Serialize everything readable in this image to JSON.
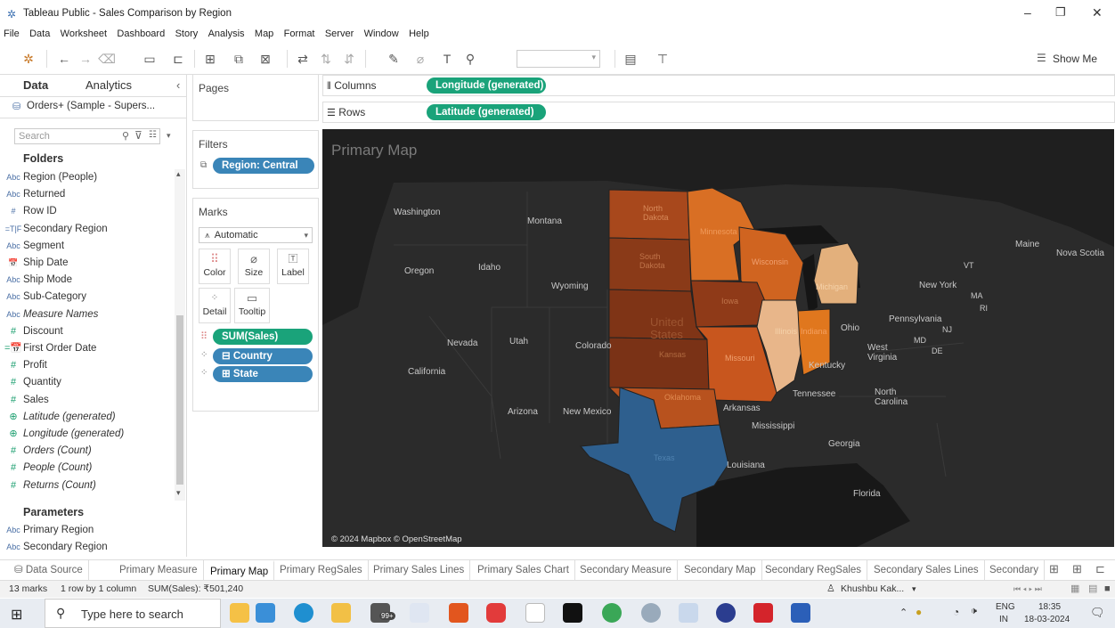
{
  "window": {
    "title": "Tableau Public - Sales Comparison by Region",
    "controls": [
      "–",
      "❐",
      "✕"
    ]
  },
  "menu": [
    "File",
    "Data",
    "Worksheet",
    "Dashboard",
    "Story",
    "Analysis",
    "Map",
    "Format",
    "Server",
    "Window",
    "Help"
  ],
  "toolbar": {
    "show_me": "Show Me"
  },
  "left_pane": {
    "tabs": [
      "Data",
      "Analytics"
    ],
    "datasource": "Orders+ (Sample - Supers...",
    "search_placeholder": "Search",
    "folders_heading": "Folders",
    "fields": [
      {
        "type": "Abc",
        "name": "Region (People)",
        "kind": "dim",
        "italic": false
      },
      {
        "type": "Abc",
        "name": "Returned",
        "kind": "dim",
        "italic": false
      },
      {
        "type": "#",
        "name": "Row ID",
        "kind": "dim",
        "italic": false
      },
      {
        "type": "=T|F",
        "name": "Secondary Region",
        "kind": "dim",
        "italic": false
      },
      {
        "type": "Abc",
        "name": "Segment",
        "kind": "dim",
        "italic": false
      },
      {
        "type": "📅",
        "name": "Ship Date",
        "kind": "dim",
        "italic": false
      },
      {
        "type": "Abc",
        "name": "Ship Mode",
        "kind": "dim",
        "italic": false
      },
      {
        "type": "Abc",
        "name": "Sub-Category",
        "kind": "dim",
        "italic": false
      },
      {
        "type": "Abc",
        "name": "Measure Names",
        "kind": "dim",
        "italic": true
      },
      {
        "type": "#",
        "name": "Discount",
        "kind": "meas",
        "italic": false
      },
      {
        "type": "=📅",
        "name": "First Order Date",
        "kind": "meas",
        "italic": false
      },
      {
        "type": "#",
        "name": "Profit",
        "kind": "meas",
        "italic": false
      },
      {
        "type": "#",
        "name": "Quantity",
        "kind": "meas",
        "italic": false
      },
      {
        "type": "#",
        "name": "Sales",
        "kind": "meas",
        "italic": false
      },
      {
        "type": "⊕",
        "name": "Latitude (generated)",
        "kind": "meas",
        "italic": true
      },
      {
        "type": "⊕",
        "name": "Longitude (generated)",
        "kind": "meas",
        "italic": true
      },
      {
        "type": "#",
        "name": "Orders (Count)",
        "kind": "meas",
        "italic": true
      },
      {
        "type": "#",
        "name": "People (Count)",
        "kind": "meas",
        "italic": true
      },
      {
        "type": "#",
        "name": "Returns (Count)",
        "kind": "meas",
        "italic": true
      }
    ],
    "parameters_heading": "Parameters",
    "parameters": [
      {
        "type": "Abc",
        "name": "Primary Region"
      },
      {
        "type": "Abc",
        "name": "Secondary Region"
      }
    ]
  },
  "cards": {
    "pages": "Pages",
    "filters": "Filters",
    "filter_pill": "Region: Central",
    "marks": "Marks",
    "mark_type": "Automatic",
    "mark_buttons": [
      "Color",
      "Size",
      "Label",
      "Detail",
      "Tooltip"
    ],
    "mark_pills": [
      "SUM(Sales)",
      "⊟ Country",
      "⊞ State"
    ]
  },
  "shelves": {
    "columns_label": "Columns",
    "columns_pill": "Longitude (generated)",
    "rows_label": "Rows",
    "rows_pill": "Latitude (generated)"
  },
  "viz": {
    "title": "Primary Map",
    "attribution": "© 2024 Mapbox © OpenStreetMap",
    "labels": {
      "washington": "Washington",
      "montana": "Montana",
      "oregon": "Oregon",
      "idaho": "Idaho",
      "wyoming": "Wyoming",
      "nevada": "Nevada",
      "utah": "Utah",
      "colorado": "Colorado",
      "california": "California",
      "arizona": "Arizona",
      "new_mexico": "New Mexico",
      "north_dakota": "North Dakota",
      "south_dakota": "South Dakota",
      "minnesota": "Minnesota",
      "wisconsin": "Wisconsin",
      "michigan": "Michigan",
      "iowa": "Iowa",
      "illinois": "Illinois",
      "indiana": "Indiana",
      "missouri": "Missouri",
      "kansas": "Kansas",
      "oklahoma": "Oklahoma",
      "texas": "Texas",
      "united_states": "United States",
      "ohio": "Ohio",
      "kentucky": "Kentucky",
      "tennessee": "Tennessee",
      "arkansas": "Arkansas",
      "mississippi": "Mississippi",
      "louisiana": "Louisiana",
      "georgia": "Georgia",
      "florida": "Florida",
      "north_carolina": "North Carolina",
      "west_virginia": "West Virginia",
      "pennsylvania": "Pennsylvania",
      "new_york": "New York",
      "maine": "Maine",
      "nova_scotia": "Nova Scotia",
      "vt": "VT",
      "ma": "MA",
      "ri": "RI",
      "md": "MD",
      "de": "DE",
      "nj": "NJ"
    }
  },
  "sheet_tabs": {
    "data_source": "Data Source",
    "tabs": [
      "Primary Measure",
      "Primary Map",
      "Primary RegSales",
      "Primary Sales Lines",
      "Primary Sales Chart",
      "Secondary Measure",
      "Secondary Map",
      "Secondary RegSales",
      "Secondary Sales Lines",
      "Secondary"
    ],
    "active": "Primary Map"
  },
  "status": {
    "marks": "13 marks",
    "layout": "1 row by 1 column",
    "sum": "SUM(Sales): ₹501,240",
    "user": "Khushbu Kak..."
  },
  "taskbar": {
    "search_placeholder": "Type here to search",
    "lang": "ENG",
    "region": "IN",
    "time": "18:35",
    "date": "18-03-2024",
    "badge": "99+"
  },
  "colors": {
    "green_pill": "#1aa37a",
    "blue_pill": "#3a85b8",
    "map_bg": "#1f1f1f",
    "texas": "#2e5f8e"
  }
}
